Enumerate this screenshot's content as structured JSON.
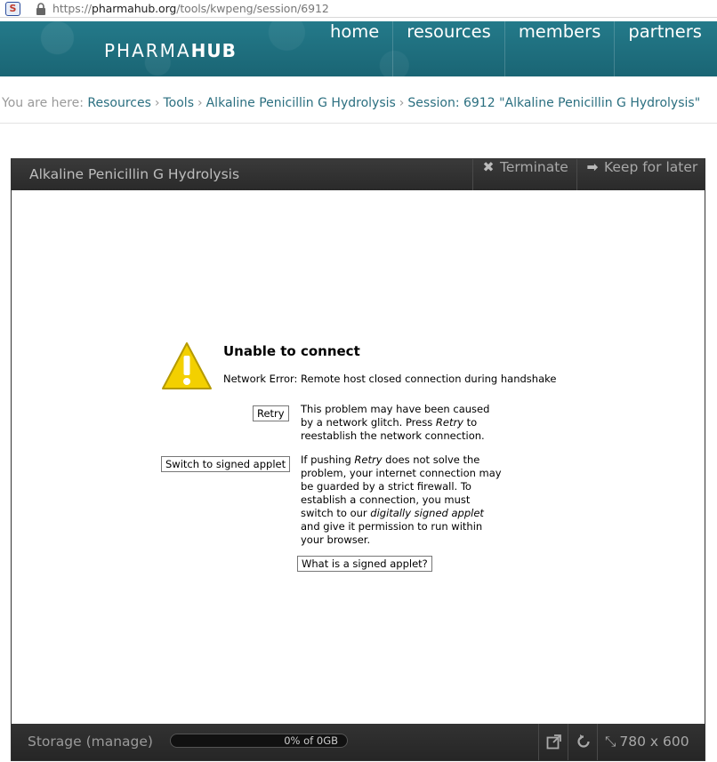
{
  "browser": {
    "favicon_letter": "S",
    "url_prefix": "https://",
    "url_host": "pharmahub.org",
    "url_path": "/tools/kwpeng/session/6912"
  },
  "header": {
    "logo_light": "PHARMA",
    "logo_bold": "HUB",
    "nav": [
      "home",
      "resources",
      "members",
      "partners"
    ],
    "bg_color": "#1e6f7f"
  },
  "breadcrumb": {
    "prefix": "You are here:",
    "items": [
      "Resources",
      "Tools",
      "Alkaline Penicillin G Hydrolysis",
      "Session: 6912 \"Alkaline Penicillin G Hydrolysis\""
    ],
    "separator": "›"
  },
  "tool": {
    "title": "Alkaline Penicillin G Hydrolysis",
    "terminate_label": "Terminate",
    "keep_label": "Keep for later"
  },
  "applet": {
    "error_title": "Unable to connect",
    "error_message": "Network Error: Remote host closed connection during handshake",
    "retry_label": "Retry",
    "retry_text": [
      {
        "t": "This problem may have been caused by a network glitch.  Press ",
        "i": false
      },
      {
        "t": "Retry",
        "i": true
      },
      {
        "t": " to reestablish the network connection.",
        "i": false
      }
    ],
    "switch_label": "Switch to signed applet",
    "switch_text": [
      {
        "t": "If pushing ",
        "i": false
      },
      {
        "t": "Retry",
        "i": true
      },
      {
        "t": " does not solve the problem, your internet connection may be guarded by a strict firewall. To establish a connection, you must switch to our ",
        "i": false
      },
      {
        "t": "digitally signed applet",
        "i": true
      },
      {
        "t": " and give it permission to run within your browser.",
        "i": false
      }
    ],
    "what_is_label": "What is a signed applet?"
  },
  "footer": {
    "storage_label": "Storage (manage)",
    "storage_percent": 0,
    "storage_text": "0% of 0GB",
    "size_label": "780 x 600"
  }
}
